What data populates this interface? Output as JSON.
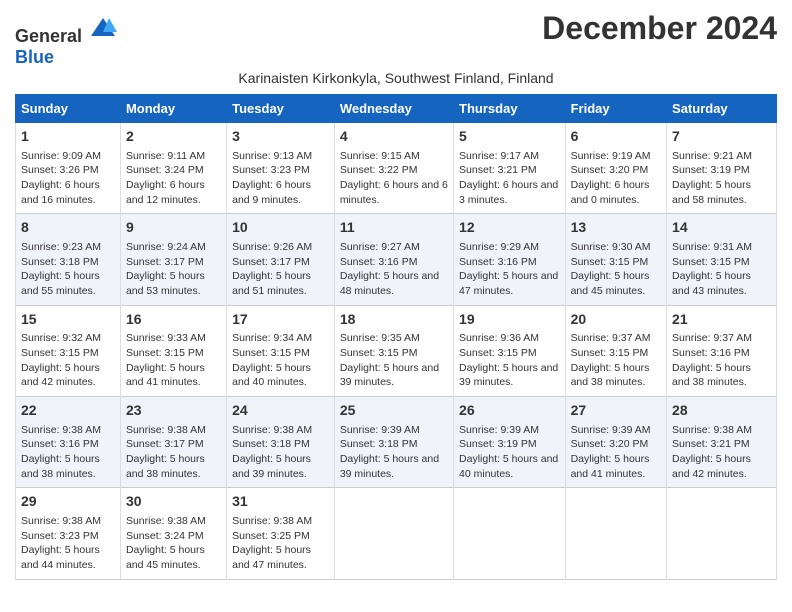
{
  "logo": {
    "general": "General",
    "blue": "Blue"
  },
  "title": "December 2024",
  "subtitle": "Karinaisten Kirkonkyla, Southwest Finland, Finland",
  "headers": [
    "Sunday",
    "Monday",
    "Tuesday",
    "Wednesday",
    "Thursday",
    "Friday",
    "Saturday"
  ],
  "weeks": [
    [
      {
        "day": "1",
        "sunrise": "9:09 AM",
        "sunset": "3:26 PM",
        "daylight": "6 hours and 16 minutes."
      },
      {
        "day": "2",
        "sunrise": "9:11 AM",
        "sunset": "3:24 PM",
        "daylight": "6 hours and 12 minutes."
      },
      {
        "day": "3",
        "sunrise": "9:13 AM",
        "sunset": "3:23 PM",
        "daylight": "6 hours and 9 minutes."
      },
      {
        "day": "4",
        "sunrise": "9:15 AM",
        "sunset": "3:22 PM",
        "daylight": "6 hours and 6 minutes."
      },
      {
        "day": "5",
        "sunrise": "9:17 AM",
        "sunset": "3:21 PM",
        "daylight": "6 hours and 3 minutes."
      },
      {
        "day": "6",
        "sunrise": "9:19 AM",
        "sunset": "3:20 PM",
        "daylight": "6 hours and 0 minutes."
      },
      {
        "day": "7",
        "sunrise": "9:21 AM",
        "sunset": "3:19 PM",
        "daylight": "5 hours and 58 minutes."
      }
    ],
    [
      {
        "day": "8",
        "sunrise": "9:23 AM",
        "sunset": "3:18 PM",
        "daylight": "5 hours and 55 minutes."
      },
      {
        "day": "9",
        "sunrise": "9:24 AM",
        "sunset": "3:17 PM",
        "daylight": "5 hours and 53 minutes."
      },
      {
        "day": "10",
        "sunrise": "9:26 AM",
        "sunset": "3:17 PM",
        "daylight": "5 hours and 51 minutes."
      },
      {
        "day": "11",
        "sunrise": "9:27 AM",
        "sunset": "3:16 PM",
        "daylight": "5 hours and 48 minutes."
      },
      {
        "day": "12",
        "sunrise": "9:29 AM",
        "sunset": "3:16 PM",
        "daylight": "5 hours and 47 minutes."
      },
      {
        "day": "13",
        "sunrise": "9:30 AM",
        "sunset": "3:15 PM",
        "daylight": "5 hours and 45 minutes."
      },
      {
        "day": "14",
        "sunrise": "9:31 AM",
        "sunset": "3:15 PM",
        "daylight": "5 hours and 43 minutes."
      }
    ],
    [
      {
        "day": "15",
        "sunrise": "9:32 AM",
        "sunset": "3:15 PM",
        "daylight": "5 hours and 42 minutes."
      },
      {
        "day": "16",
        "sunrise": "9:33 AM",
        "sunset": "3:15 PM",
        "daylight": "5 hours and 41 minutes."
      },
      {
        "day": "17",
        "sunrise": "9:34 AM",
        "sunset": "3:15 PM",
        "daylight": "5 hours and 40 minutes."
      },
      {
        "day": "18",
        "sunrise": "9:35 AM",
        "sunset": "3:15 PM",
        "daylight": "5 hours and 39 minutes."
      },
      {
        "day": "19",
        "sunrise": "9:36 AM",
        "sunset": "3:15 PM",
        "daylight": "5 hours and 39 minutes."
      },
      {
        "day": "20",
        "sunrise": "9:37 AM",
        "sunset": "3:15 PM",
        "daylight": "5 hours and 38 minutes."
      },
      {
        "day": "21",
        "sunrise": "9:37 AM",
        "sunset": "3:16 PM",
        "daylight": "5 hours and 38 minutes."
      }
    ],
    [
      {
        "day": "22",
        "sunrise": "9:38 AM",
        "sunset": "3:16 PM",
        "daylight": "5 hours and 38 minutes."
      },
      {
        "day": "23",
        "sunrise": "9:38 AM",
        "sunset": "3:17 PM",
        "daylight": "5 hours and 38 minutes."
      },
      {
        "day": "24",
        "sunrise": "9:38 AM",
        "sunset": "3:18 PM",
        "daylight": "5 hours and 39 minutes."
      },
      {
        "day": "25",
        "sunrise": "9:39 AM",
        "sunset": "3:18 PM",
        "daylight": "5 hours and 39 minutes."
      },
      {
        "day": "26",
        "sunrise": "9:39 AM",
        "sunset": "3:19 PM",
        "daylight": "5 hours and 40 minutes."
      },
      {
        "day": "27",
        "sunrise": "9:39 AM",
        "sunset": "3:20 PM",
        "daylight": "5 hours and 41 minutes."
      },
      {
        "day": "28",
        "sunrise": "9:38 AM",
        "sunset": "3:21 PM",
        "daylight": "5 hours and 42 minutes."
      }
    ],
    [
      {
        "day": "29",
        "sunrise": "9:38 AM",
        "sunset": "3:23 PM",
        "daylight": "5 hours and 44 minutes."
      },
      {
        "day": "30",
        "sunrise": "9:38 AM",
        "sunset": "3:24 PM",
        "daylight": "5 hours and 45 minutes."
      },
      {
        "day": "31",
        "sunrise": "9:38 AM",
        "sunset": "3:25 PM",
        "daylight": "5 hours and 47 minutes."
      },
      null,
      null,
      null,
      null
    ]
  ],
  "labels": {
    "sunrise": "Sunrise:",
    "sunset": "Sunset:",
    "daylight": "Daylight:"
  },
  "colors": {
    "header_bg": "#1565c0",
    "even_row": "#f0f4fa"
  }
}
